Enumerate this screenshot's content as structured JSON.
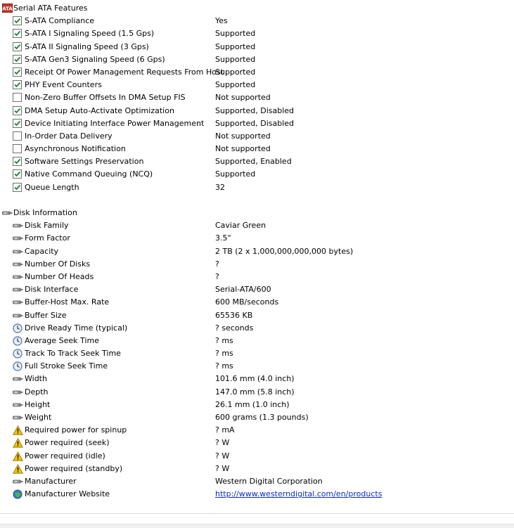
{
  "sections": [
    {
      "title": "Serial ATA Features",
      "icon": "ata-icon",
      "items": [
        {
          "label": "S-ATA Compliance",
          "value": "Yes",
          "icon": "checkbox-checked"
        },
        {
          "label": "S-ATA I Signaling Speed (1.5 Gps)",
          "value": "Supported",
          "icon": "checkbox-checked"
        },
        {
          "label": "S-ATA II Signaling Speed (3 Gps)",
          "value": "Supported",
          "icon": "checkbox-checked"
        },
        {
          "label": "S-ATA Gen3 Signaling Speed (6 Gps)",
          "value": "Supported",
          "icon": "checkbox-checked"
        },
        {
          "label": "Receipt Of Power Management Requests From Host",
          "value": "Supported",
          "icon": "checkbox-checked"
        },
        {
          "label": "PHY Event Counters",
          "value": "Supported",
          "icon": "checkbox-checked"
        },
        {
          "label": "Non-Zero Buffer Offsets In DMA Setup FIS",
          "value": "Not supported",
          "icon": "checkbox-unchecked"
        },
        {
          "label": "DMA Setup Auto-Activate Optimization",
          "value": "Supported, Disabled",
          "icon": "checkbox-checked"
        },
        {
          "label": "Device Initiating Interface Power Management",
          "value": "Supported, Disabled",
          "icon": "checkbox-checked"
        },
        {
          "label": "In-Order Data Delivery",
          "value": "Not supported",
          "icon": "checkbox-unchecked"
        },
        {
          "label": "Asynchronous Notification",
          "value": "Not supported",
          "icon": "checkbox-unchecked"
        },
        {
          "label": "Software Settings Preservation",
          "value": "Supported, Enabled",
          "icon": "checkbox-checked"
        },
        {
          "label": "Native Command Queuing (NCQ)",
          "value": "Supported",
          "icon": "checkbox-checked"
        },
        {
          "label": "Queue Length",
          "value": "32",
          "icon": "checkbox-checked"
        }
      ]
    },
    {
      "title": "Disk Information",
      "icon": "disk-icon",
      "items": [
        {
          "label": "Disk Family",
          "value": "Caviar Green",
          "icon": "disk-icon"
        },
        {
          "label": "Form Factor",
          "value": "3.5\"",
          "icon": "disk-icon"
        },
        {
          "label": "Capacity",
          "value": "2 TB (2 x 1,000,000,000,000 bytes)",
          "icon": "disk-icon"
        },
        {
          "label": "Number Of Disks",
          "value": "?",
          "icon": "disk-icon"
        },
        {
          "label": "Number Of Heads",
          "value": "?",
          "icon": "disk-icon"
        },
        {
          "label": "Disk Interface",
          "value": "Serial-ATA/600",
          "icon": "disk-icon"
        },
        {
          "label": "Buffer-Host Max. Rate",
          "value": "600 MB/seconds",
          "icon": "disk-icon"
        },
        {
          "label": "Buffer Size",
          "value": "65536 KB",
          "icon": "disk-icon"
        },
        {
          "label": "Drive Ready Time (typical)",
          "value": "? seconds",
          "icon": "clock-icon"
        },
        {
          "label": "Average Seek Time",
          "value": "? ms",
          "icon": "clock-icon"
        },
        {
          "label": "Track To Track Seek Time",
          "value": "? ms",
          "icon": "clock-icon"
        },
        {
          "label": "Full Stroke Seek Time",
          "value": "? ms",
          "icon": "clock-icon"
        },
        {
          "label": "Width",
          "value": "101.6 mm (4.0 inch)",
          "icon": "disk-icon"
        },
        {
          "label": "Depth",
          "value": "147.0 mm (5.8 inch)",
          "icon": "disk-icon"
        },
        {
          "label": "Height",
          "value": "26.1 mm (1.0 inch)",
          "icon": "disk-icon"
        },
        {
          "label": "Weight",
          "value": "600 grams (1.3 pounds)",
          "icon": "disk-icon"
        },
        {
          "label": "Required power for spinup",
          "value": "? mA",
          "icon": "warning-icon"
        },
        {
          "label": "Power required (seek)",
          "value": "? W",
          "icon": "warning-icon"
        },
        {
          "label": "Power required (idle)",
          "value": "? W",
          "icon": "warning-icon"
        },
        {
          "label": "Power required (standby)",
          "value": "? W",
          "icon": "warning-icon"
        },
        {
          "label": "Manufacturer",
          "value": "Western Digital Corporation",
          "icon": "disk-icon"
        },
        {
          "label": "Manufacturer Website",
          "value": "http://www.westerndigital.com/en/products",
          "icon": "globe-icon",
          "link": true
        }
      ]
    }
  ],
  "colors": {
    "link": "#0b2fbf",
    "check": "#1a7f2a",
    "warning": "#f2c200",
    "ata_badge": "#c0392b"
  }
}
